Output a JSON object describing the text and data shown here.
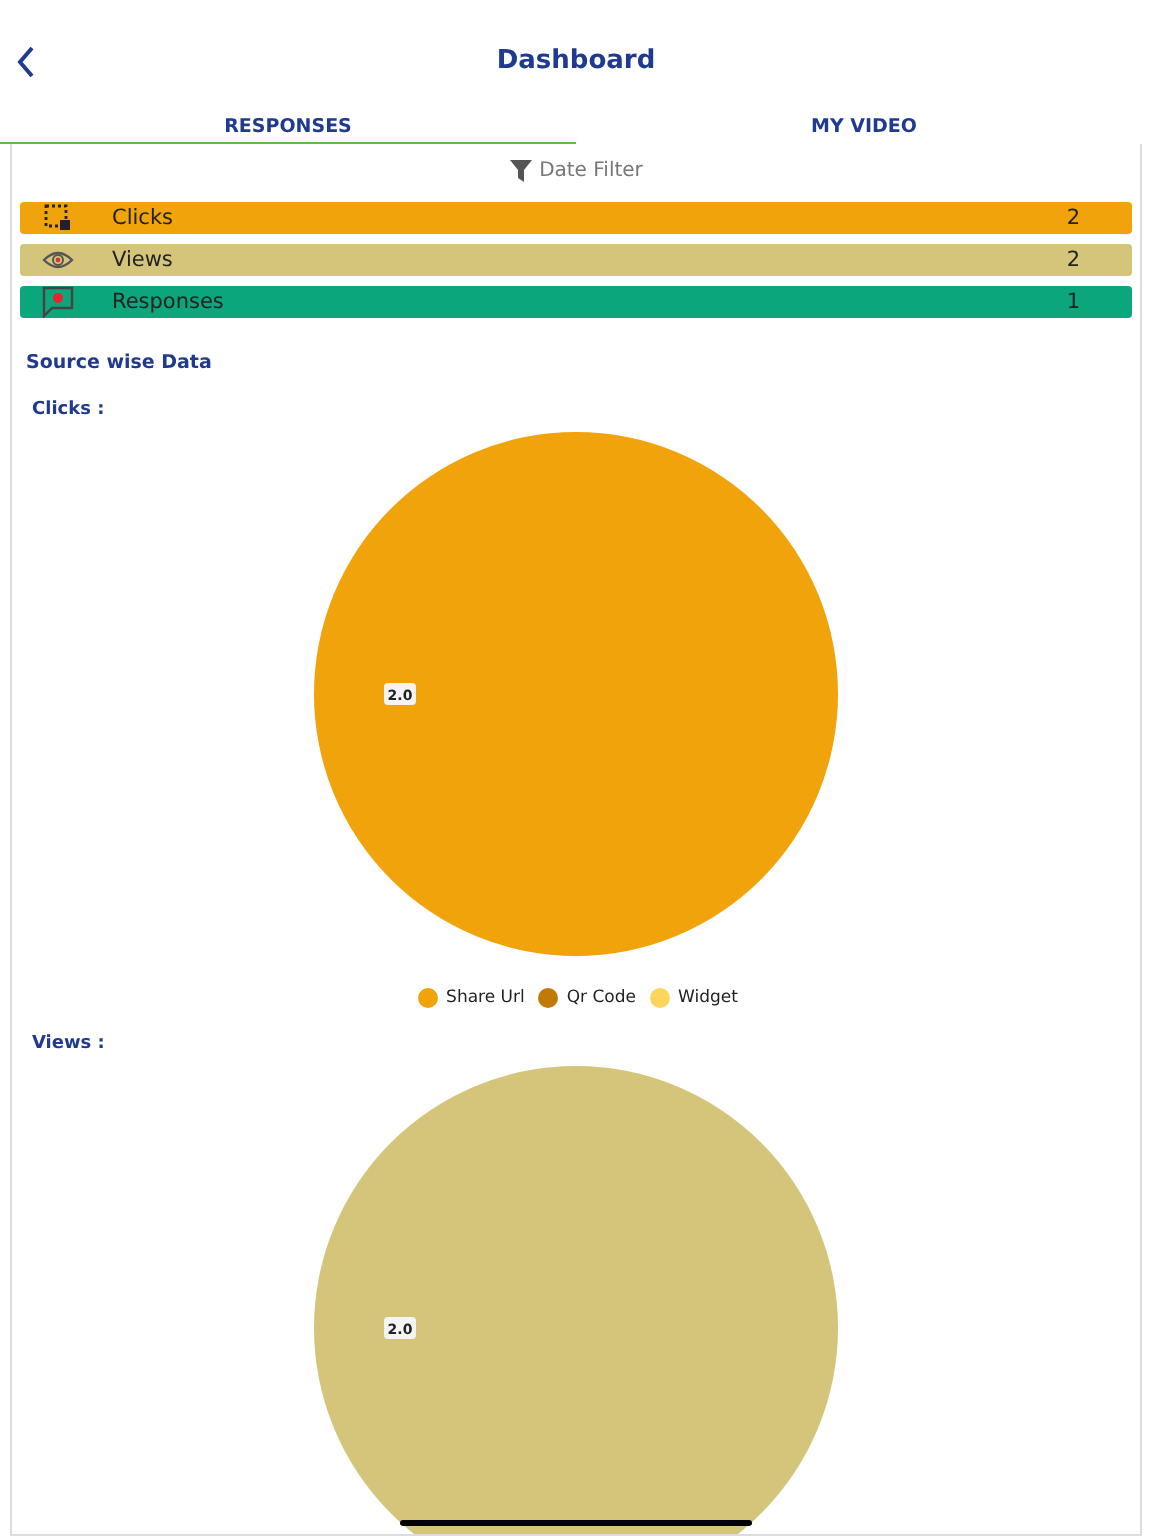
{
  "header": {
    "title": "Dashboard"
  },
  "tabs": [
    {
      "label": "RESPONSES",
      "selected": true
    },
    {
      "label": "MY VIDEO",
      "selected": false
    }
  ],
  "date_filter": {
    "label": "Date Filter"
  },
  "stats": [
    {
      "kind": "clicks",
      "label": "Clicks",
      "value": "2",
      "color": "#f0a30a"
    },
    {
      "kind": "views",
      "label": "Views",
      "value": "2",
      "color": "#d5c57a"
    },
    {
      "kind": "responses",
      "label": "Responses",
      "value": "1",
      "color": "#0ca67c"
    }
  ],
  "section_title": "Source wise Data",
  "charts": [
    {
      "heading": "Clicks :",
      "chart_data": {
        "type": "pie",
        "categories": [
          "Share Url",
          "Qr Code",
          "Widget"
        ],
        "values": [
          2,
          0,
          0
        ],
        "value_labels": [
          "2.0",
          null,
          null
        ]
      },
      "slices": [
        {
          "color": "#f0a30a"
        },
        {
          "color": "#c07a06"
        },
        {
          "color": "#fdd55c"
        }
      ]
    },
    {
      "heading": "Views :",
      "chart_data": {
        "type": "pie",
        "values": [
          2
        ],
        "value_labels": [
          "2.0"
        ]
      },
      "slices": [
        {
          "color": "#d5c57a"
        }
      ]
    }
  ]
}
